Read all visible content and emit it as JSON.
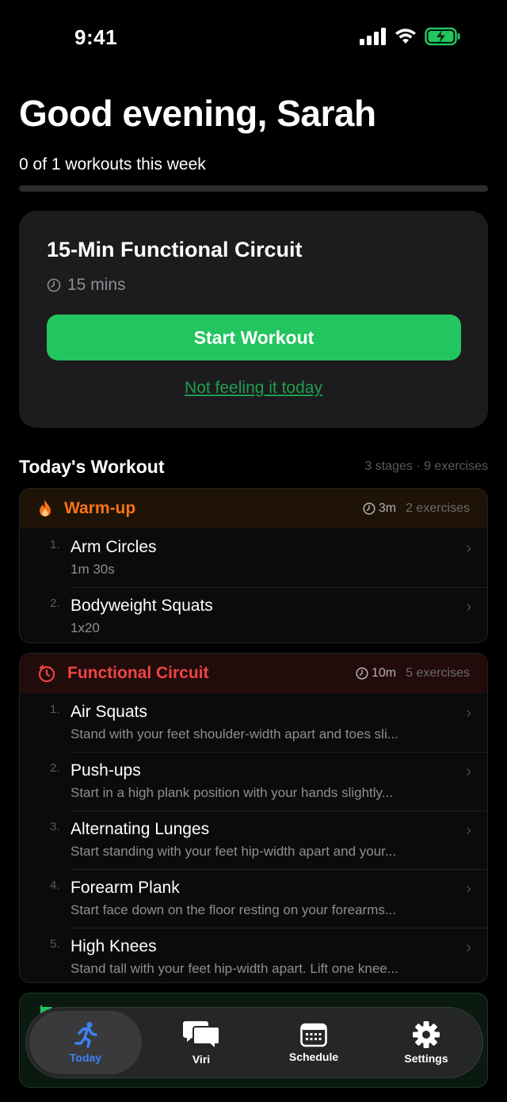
{
  "status": {
    "time": "9:41"
  },
  "greeting": "Good evening, Sarah",
  "weekly": {
    "text": "0 of 1 workouts this week",
    "progress_fraction": 0
  },
  "hero": {
    "title": "15-Min Functional Circuit",
    "duration": "15 mins",
    "start_label": "Start Workout",
    "skip_label": "Not feeling it today"
  },
  "today": {
    "title": "Today's Workout",
    "meta": "3 stages · 9 exercises"
  },
  "stages": [
    {
      "name": "Warm-up",
      "time": "3m",
      "count": "2 exercises",
      "icon": "flame-icon",
      "color": "#f97316",
      "header_bg": "#1e1306",
      "exercises": [
        {
          "num": "1.",
          "name": "Arm Circles",
          "detail": "1m 30s"
        },
        {
          "num": "2.",
          "name": "Bodyweight Squats",
          "detail": "1x20"
        }
      ]
    },
    {
      "name": "Functional Circuit",
      "time": "10m",
      "count": "5 exercises",
      "icon": "timer-icon",
      "color": "#ef4444",
      "header_bg": "#220b0b",
      "exercises": [
        {
          "num": "1.",
          "name": "Air Squats",
          "detail": "Stand with your feet shoulder-width apart and toes sli..."
        },
        {
          "num": "2.",
          "name": "Push-ups",
          "detail": "Start in a high plank position with your hands slightly..."
        },
        {
          "num": "3.",
          "name": "Alternating Lunges",
          "detail": "Start standing with your feet hip-width apart and your..."
        },
        {
          "num": "4.",
          "name": "Forearm Plank",
          "detail": "Start face down on the floor resting on your forearms..."
        },
        {
          "num": "5.",
          "name": "High Knees",
          "detail": "Stand tall with your feet hip-width apart. Lift one knee..."
        }
      ]
    }
  ],
  "tabs": [
    {
      "label": "Today",
      "icon": "runner-icon",
      "active": true
    },
    {
      "label": "Viri",
      "icon": "chat-bubbles-icon",
      "active": false
    },
    {
      "label": "Schedule",
      "icon": "calendar-icon",
      "active": false
    },
    {
      "label": "Settings",
      "icon": "gear-icon",
      "active": false
    }
  ],
  "colors": {
    "accent_green": "#22c55e",
    "tab_active": "#3b82f6"
  }
}
